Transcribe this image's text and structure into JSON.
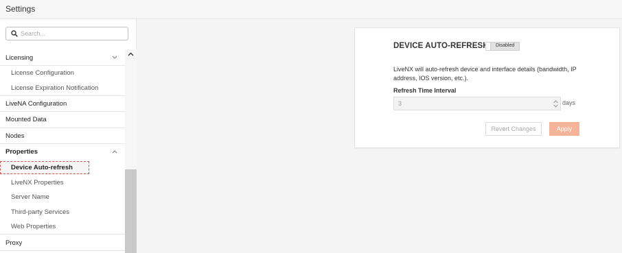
{
  "app": {
    "title": "Settings"
  },
  "search": {
    "placeholder": "Search..."
  },
  "nav": {
    "licensing": "Licensing",
    "license_configuration": "License Configuration",
    "license_expiration": "License Expiration Notification",
    "livena_configuration": "LiveNA Configuration",
    "mounted_data": "Mounted Data",
    "nodes": "Nodes",
    "properties": "Properties",
    "device_auto_refresh": "Device Auto-refresh",
    "livenx_properties": "LiveNX Properties",
    "server_name": "Server Name",
    "third_party_services": "Third-party Services",
    "web_properties": "Web Properties",
    "proxy": "Proxy"
  },
  "card": {
    "title": "DEVICE AUTO-REFRESH",
    "toggle_label": "Disabled",
    "description": "LiveNX will auto-refresh device and interface details (bandwidth, IP address, IOS version, etc.).",
    "field_label": "Refresh Time Interval",
    "interval_value": "3",
    "unit": "days",
    "revert_label": "Revert Changes",
    "apply_label": "Apply"
  },
  "colors": {
    "accent": "#f6b397",
    "selection_border": "#d9534f"
  },
  "icons": {
    "search": "search-icon",
    "chevron": "chevron-icon",
    "spinner": "spinner-icon"
  }
}
